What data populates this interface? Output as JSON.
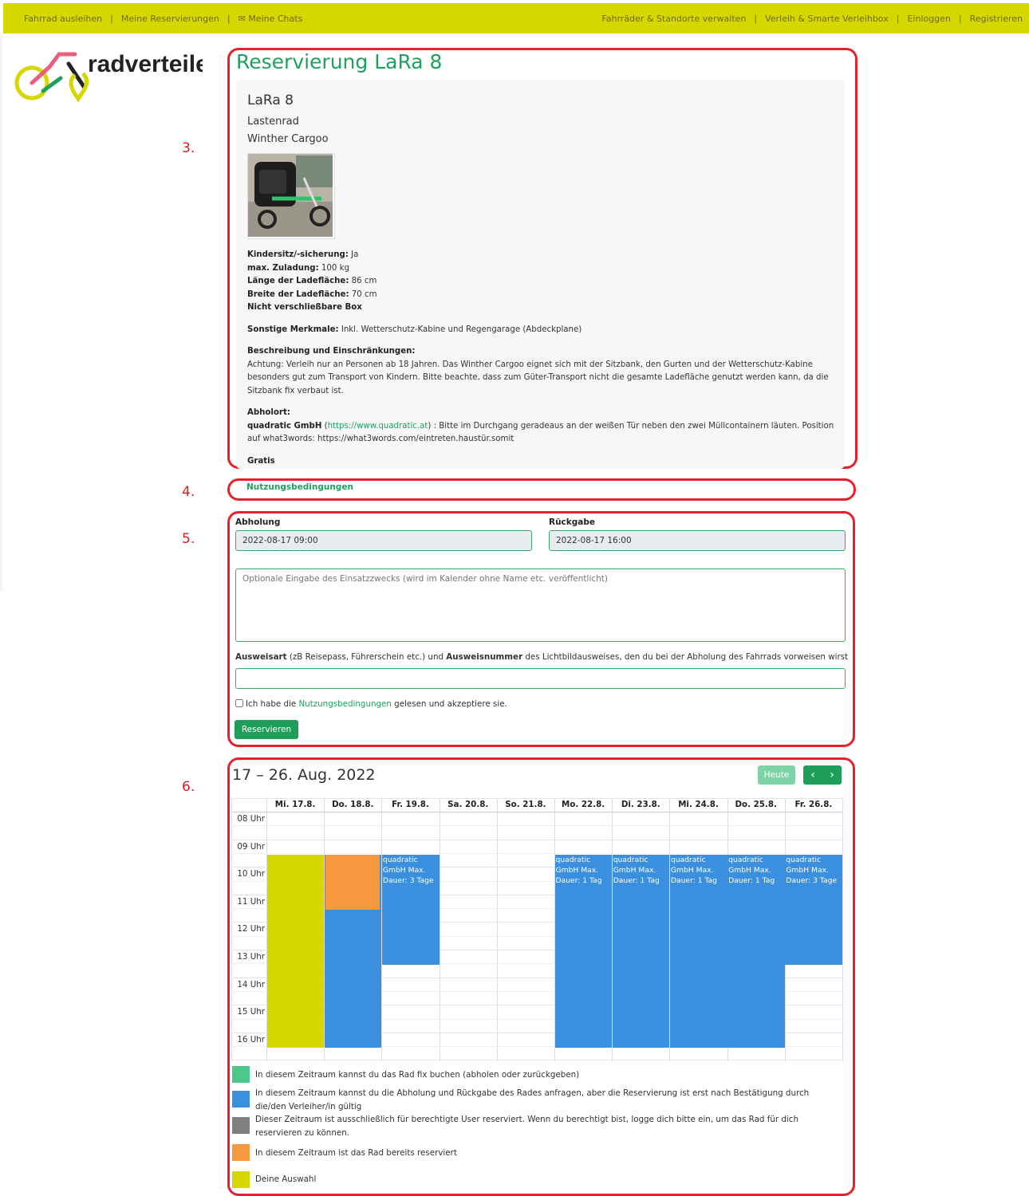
{
  "nav": {
    "left": [
      "Fahrrad ausleihen",
      "Meine Reservierungen",
      "Meine Chats"
    ],
    "right": [
      "Fahrräder & Standorte verwalten",
      "Verleih & Smarte Verleihbox",
      "Einloggen",
      "Registrieren"
    ],
    "separator": "|"
  },
  "logo": {
    "text": "radverteiler"
  },
  "steps": [
    "3.",
    "4.",
    "5.",
    "6."
  ],
  "page_title": "Reservierung LaRa 8",
  "bike": {
    "name": "LaRa 8",
    "type": "Lastenrad",
    "model": "Winther Cargoo",
    "specs": [
      {
        "label": "Kindersitz/-sicherung:",
        "value": " Ja"
      },
      {
        "label": "max. Zuladung:",
        "value": " 100 kg"
      },
      {
        "label": "Länge der Ladefläche:",
        "value": " 86 cm"
      },
      {
        "label": "Breite der Ladefläche:",
        "value": " 70 cm"
      },
      {
        "label": "Nicht verschließbare Box",
        "value": ""
      }
    ],
    "features_label": "Sonstige Merkmale:",
    "features": " Inkl. Wetterschutz-Kabine und Regengarage (Abdeckplane)",
    "desc_label": "Beschreibung und Einschränkungen:",
    "desc": "Achtung: Verleih nur an Personen ab 18 Jahren. Das Winther Cargoo eignet sich mit der Sitzbank, den Gurten und der Wetterschutz-Kabine besonders gut zum Transport von Kindern. Bitte beachte, dass zum Güter-Transport nicht die gesamte Ladefläche genutzt werden kann, da die Sitzbank fix verbaut ist.",
    "pickup_label": "Abholort:",
    "pickup_company": "quadratic GmbH",
    "pickup_url": "https://www.quadratic.at",
    "pickup_text": " : Bitte im Durchgang geradeaus an der weißen Tür neben den zwei Müllcontainern läuten. Position auf what3words: https://what3words.com/eintreten.haustür.somit",
    "price": "Gratis"
  },
  "terms_link": "Nutzungsbedingungen",
  "form": {
    "pickup_label": "Abholung",
    "pickup_value": "2022-08-17 09:00",
    "return_label": "Rückgabe",
    "return_value": "2022-08-17 16:00",
    "purpose_placeholder": "Optionale Eingabe des Einsatzzwecks (wird im Kalender ohne Name etc. veröffentlicht)",
    "id_part1": "Ausweisart",
    "id_part2": " (zB Reisepass, Führerschein etc.) und ",
    "id_part3": "Ausweisnummer",
    "id_part4": " des Lichtbildausweises, den du bei der Abholung des Fahrrads vorweisen wirst",
    "accept_pre": "Ich habe die ",
    "accept_link": "Nutzungsbedingungen",
    "accept_post": " gelesen und akzeptiere sie.",
    "submit": "Reservieren"
  },
  "calendar": {
    "range": "17 – 26. Aug. 2022",
    "today": "Heute",
    "prev": "‹",
    "next": "›",
    "days": [
      "Mi. 17.8.",
      "Do. 18.8.",
      "Fr. 19.8.",
      "Sa. 20.8.",
      "So. 21.8.",
      "Mo. 22.8.",
      "Di. 23.8.",
      "Mi. 24.8.",
      "Do. 25.8.",
      "Fr. 26.8."
    ],
    "hours": [
      "08 Uhr",
      "09 Uhr",
      "10 Uhr",
      "11 Uhr",
      "12 Uhr",
      "13 Uhr",
      "14 Uhr",
      "15 Uhr",
      "16 Uhr"
    ],
    "events": [
      {
        "day": 0,
        "start": 9,
        "end": 16,
        "color": "#d7d700",
        "text": ""
      },
      {
        "day": 1,
        "start": 9,
        "end": 16,
        "color": "#3a8fde",
        "text": ""
      },
      {
        "day": 1,
        "start": 9,
        "end": 11,
        "color": "#f5983e",
        "text": ""
      },
      {
        "day": 2,
        "start": 9,
        "end": 13,
        "color": "#3a8fde",
        "text": "quadratic GmbH Max. Dauer: 3 Tage"
      },
      {
        "day": 5,
        "start": 9,
        "end": 16,
        "color": "#3a8fde",
        "text": "quadratic GmbH Max. Dauer: 1 Tag"
      },
      {
        "day": 6,
        "start": 9,
        "end": 16,
        "color": "#3a8fde",
        "text": "quadratic GmbH Max. Dauer: 1 Tag"
      },
      {
        "day": 7,
        "start": 9,
        "end": 16,
        "color": "#3a8fde",
        "text": "quadratic GmbH Max. Dauer: 1 Tag"
      },
      {
        "day": 8,
        "start": 9,
        "end": 16,
        "color": "#3a8fde",
        "text": "quadratic GmbH Max. Dauer: 1 Tag"
      },
      {
        "day": 9,
        "start": 9,
        "end": 13,
        "color": "#3a8fde",
        "text": "quadratic GmbH Max. Dauer: 3 Tage"
      }
    ]
  },
  "legend": [
    {
      "color": "#4cc98a",
      "text": "In diesem Zeitraum kannst du das Rad fix buchen (abholen oder zurückgeben)"
    },
    {
      "color": "#3a8fde",
      "text": "In diesem Zeitraum kannst du die Abholung und Rückgabe des Rades anfragen, aber die Reservierung ist erst nach Bestätigung durch die/den Verleiher/in gültig"
    },
    {
      "color": "#808080",
      "text": "Dieser Zeitraum ist ausschließlich für berechtigte User reserviert. Wenn du berechtigt bist, logge dich bitte ein, um das Rad für dich reservieren zu können."
    },
    {
      "color": "#f5983e",
      "text": "In diesem Zeitraum ist das Rad bereits reserviert"
    },
    {
      "color": "#d7d700",
      "text": "Deine Auswahl"
    }
  ]
}
